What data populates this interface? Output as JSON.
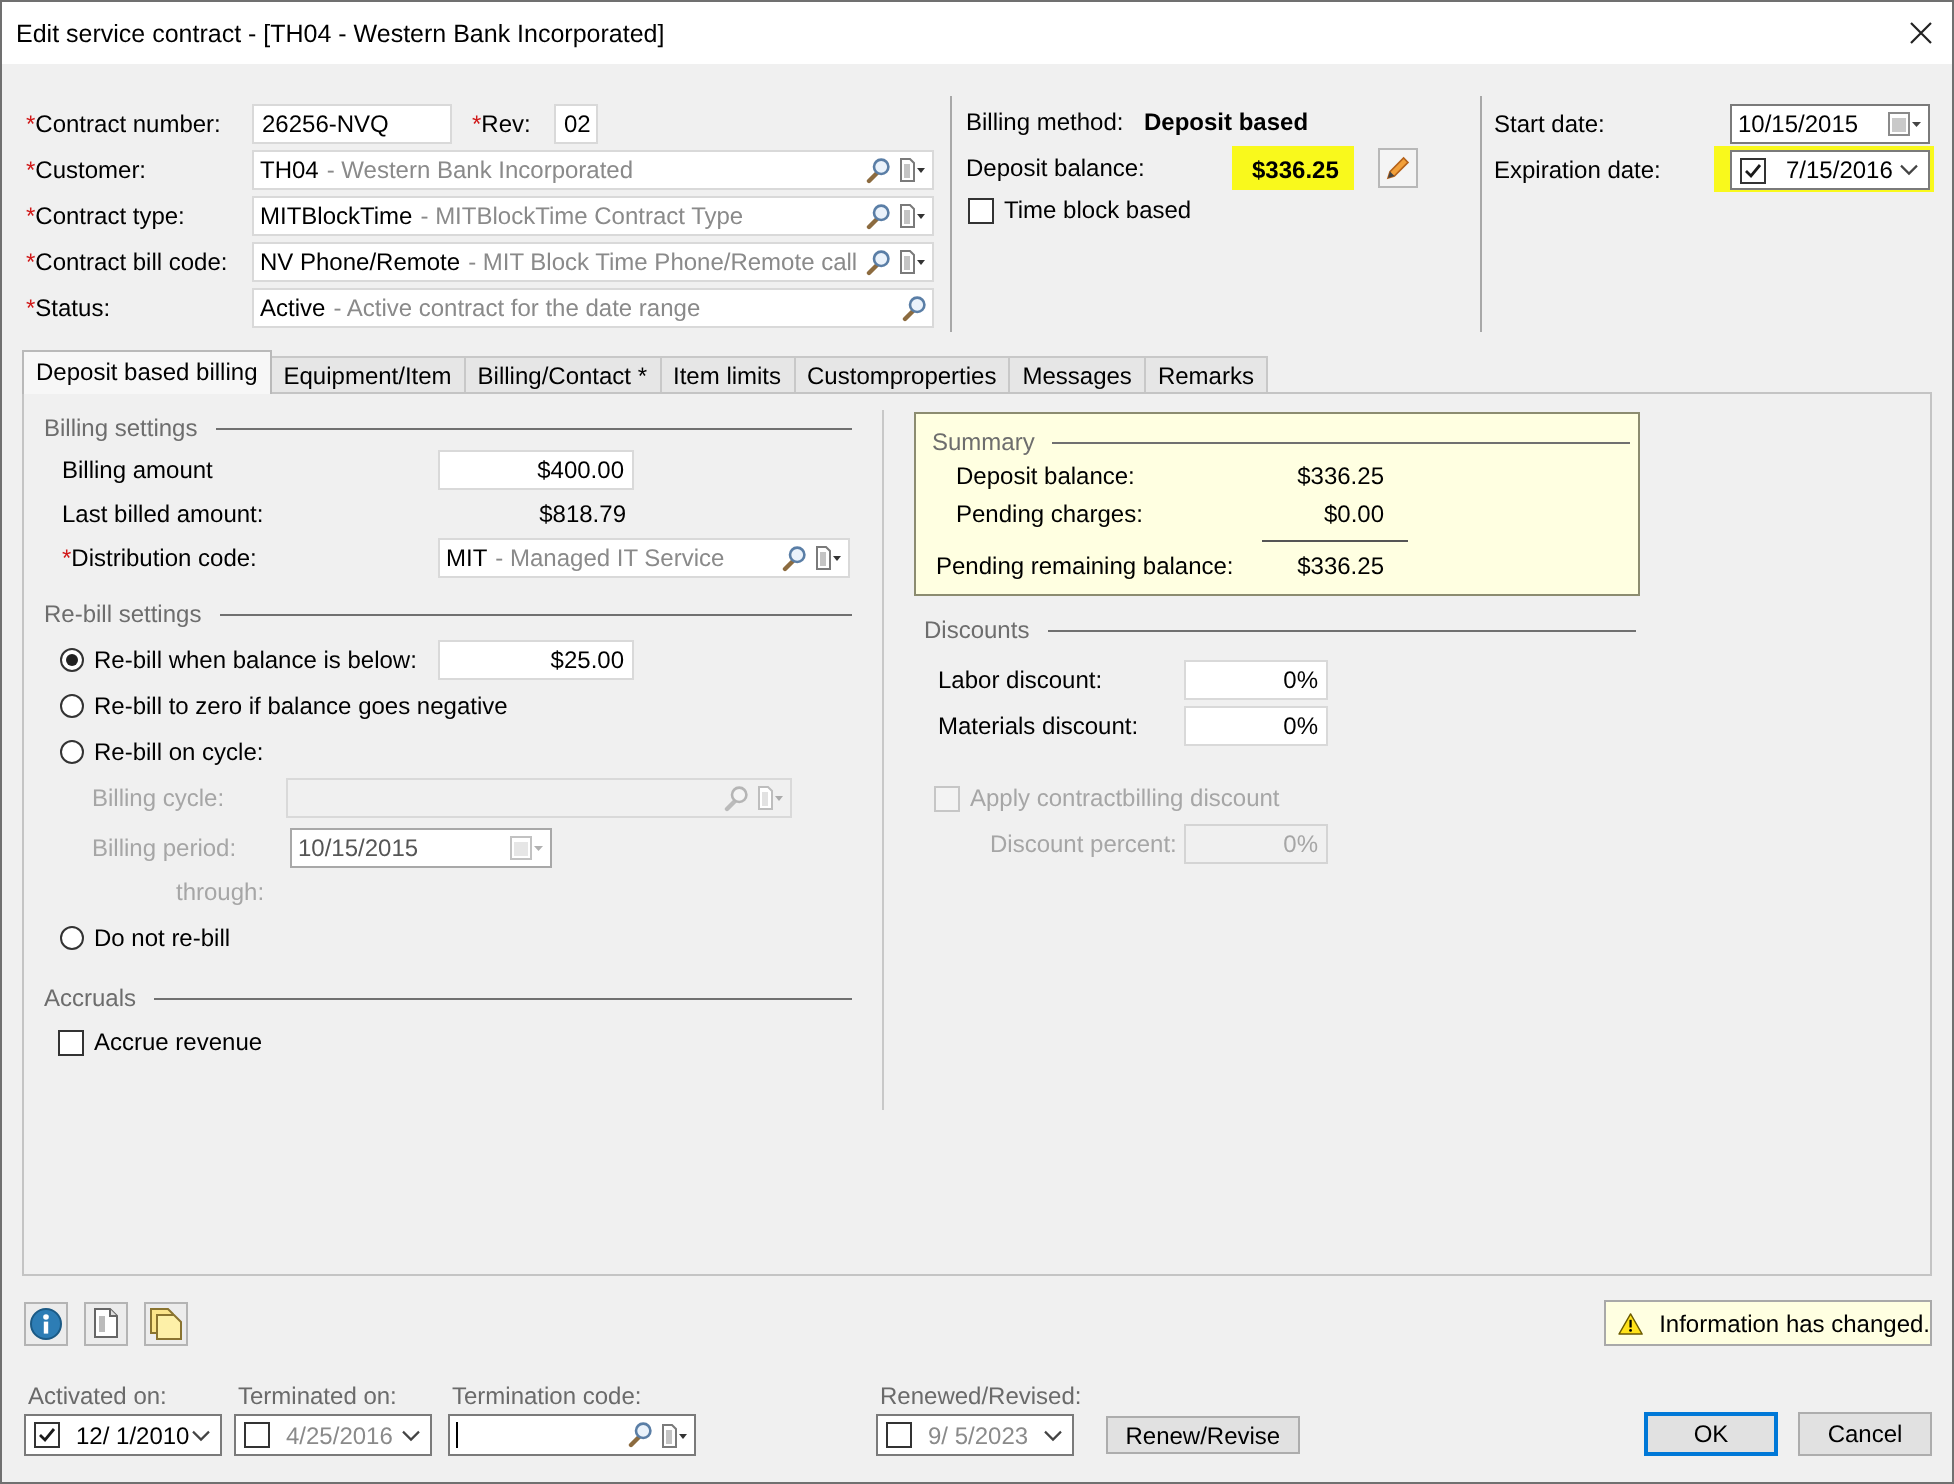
{
  "window": {
    "title": "Edit service contract - [TH04 - Western Bank Incorporated]"
  },
  "contract": {
    "number": {
      "label": "Contract number:",
      "mark": "*",
      "value": "26256-NVQ"
    },
    "rev": {
      "label": "Rev:",
      "mark": "*",
      "value": "02"
    },
    "lookups": [
      {
        "label": "Customer:",
        "mark": "*",
        "code": "TH04",
        "description": "- Western Bank Incorporated",
        "has_menu": true
      },
      {
        "label": "Contract type:",
        "mark": "*",
        "code": "MITBlockTime",
        "description": "- MITBlockTime Contract Type",
        "has_menu": true
      },
      {
        "label": "Contract bill code:",
        "mark": "*",
        "code": "NV Phone/Remote",
        "description": "- MIT Block Time Phone/Remote call",
        "has_menu": true
      },
      {
        "label": "Status:",
        "mark": "*",
        "code": "Active",
        "description": "- Active contract for the date range",
        "has_menu": false
      }
    ]
  },
  "billing": {
    "method_label": "Billing method:",
    "method": "Deposit based",
    "balance_label": "Deposit balance:",
    "balance": "$336.25",
    "balance_highlighted": true,
    "time_block": {
      "label": "Time block based",
      "checked": false
    }
  },
  "dates": {
    "start": {
      "label": "Start date:",
      "value": "10/15/2015"
    },
    "expiration": {
      "label": "Expiration date:",
      "value": "7/15/2016",
      "checked": true,
      "highlighted": true
    }
  },
  "tabs": [
    {
      "label": "Deposit based billing",
      "selected": true
    },
    {
      "label": "Equipment/Item",
      "selected": false
    },
    {
      "label": "Billing/Contact *",
      "selected": false
    },
    {
      "label": "Item limits",
      "selected": false
    },
    {
      "label": "Customproperties",
      "selected": false
    },
    {
      "label": "Messages",
      "selected": false
    },
    {
      "label": "Remarks",
      "selected": false
    }
  ],
  "billing_settings": {
    "title": "Billing settings",
    "amount": {
      "label": "Billing amount",
      "value": "$400.00"
    },
    "last_billed": {
      "label": "Last billed amount:",
      "value": "$818.79"
    },
    "distribution": {
      "label": "Distribution code:",
      "mark": "*",
      "code": "MIT",
      "description": "- Managed IT Service",
      "has_menu": true
    }
  },
  "rebill": {
    "title": "Re-bill settings",
    "options": [
      {
        "label": "Re-bill when balance is below:",
        "selected": true,
        "value": "$25.00"
      },
      {
        "label": "Re-bill to zero if balance goes negative",
        "selected": false
      },
      {
        "label": "Re-bill on cycle:",
        "selected": false,
        "cycle": {
          "disabled": true,
          "cycle_label": "Billing cycle:",
          "cycle_field": {
            "has_menu": true
          },
          "period_label": "Billing period:",
          "period_value": "10/15/2015",
          "through_label": "through:"
        }
      },
      {
        "label": "Do not re-bill",
        "selected": false
      }
    ]
  },
  "accruals": {
    "title": "Accruals",
    "accrue": {
      "label": "Accrue revenue",
      "checked": false
    }
  },
  "summary": {
    "title": "Summary",
    "rows": [
      {
        "kind": "line",
        "label": "Deposit balance:",
        "value": "$336.25"
      },
      {
        "kind": "line",
        "label": "Pending charges:",
        "value": "$0.00"
      },
      {
        "kind": "total",
        "label": "Pending remaining balance:",
        "value": "$336.25"
      }
    ]
  },
  "discounts": {
    "title": "Discounts",
    "rows": [
      {
        "label": "Labor discount:",
        "value": "0%"
      },
      {
        "label": "Materials discount:",
        "value": "0%"
      }
    ],
    "apply": {
      "label": "Apply contractbilling discount",
      "checked": false,
      "disabled": true
    },
    "percent": {
      "label": "Discount percent:",
      "value": "0%",
      "disabled": true
    }
  },
  "notice": {
    "kind": "warning",
    "text": "Information has changed."
  },
  "footer": {
    "activated": {
      "label": "Activated on:",
      "value": "12/ 1/2010",
      "checked": true
    },
    "terminated": {
      "label": "Terminated on:",
      "value": "4/25/2016",
      "checked": false
    },
    "termination_code": {
      "label": "Termination code:",
      "focused": true,
      "has_menu": true
    },
    "renewed": {
      "label": "Renewed/Revised:",
      "value": "9/ 5/2023",
      "checked": false
    },
    "renew_button": "Renew/Revise",
    "buttons": [
      {
        "label": "OK",
        "default": true
      },
      {
        "label": "Cancel",
        "default": false
      }
    ]
  }
}
